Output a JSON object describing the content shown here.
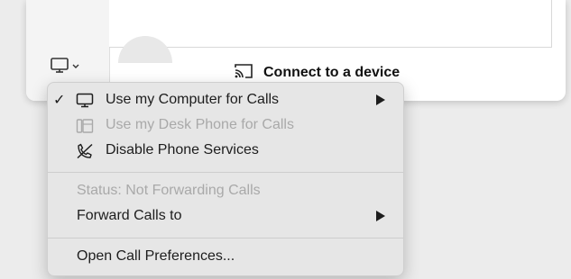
{
  "connect": {
    "label": "Connect to a device",
    "icon": "cast-icon"
  },
  "device_toggle": {
    "icon": "computer-icon",
    "chevron_icon": "chevron-down-icon"
  },
  "menu": {
    "items": [
      {
        "label": "Use my Computer for Calls",
        "checked": true,
        "enabled": true,
        "icon": "computer-icon",
        "submenu": true
      },
      {
        "label": "Use my Desk Phone for Calls",
        "checked": false,
        "enabled": false,
        "icon": "desk-phone-icon",
        "submenu": false
      },
      {
        "label": "Disable Phone Services",
        "checked": false,
        "enabled": true,
        "icon": "phone-slash-icon",
        "submenu": false
      }
    ],
    "status": "Status: Not Forwarding Calls",
    "forward_label": "Forward Calls to",
    "preferences_label": "Open Call Preferences..."
  }
}
